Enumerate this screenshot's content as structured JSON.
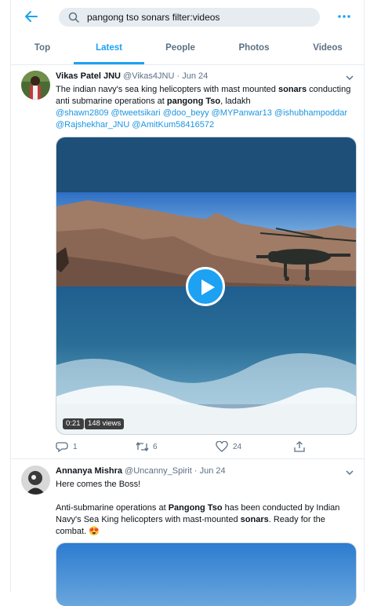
{
  "search": {
    "query": "pangong tso sonars filter:videos"
  },
  "tabs": [
    "Top",
    "Latest",
    "People",
    "Photos",
    "Videos"
  ],
  "active_tab": "Latest",
  "tweets": [
    {
      "name": "Vikas Patel JNU",
      "handle": "@Vikas4JNU",
      "sep": "·",
      "date": "Jun 24",
      "text_a": "The indian navy's sea king helicopters with mast mounted ",
      "text_b": "sonars",
      "text_c": " conducting anti submarine operations at ",
      "text_d": "pangong Tso",
      "text_e": ", ladakh",
      "mentions": [
        "@shawn2809",
        "@tweetsikari",
        "@doo_beyy",
        "@MYPanwar13",
        "@ishubhampoddar",
        "@Rajshekhar_JNU",
        "@AmitKum58416572"
      ],
      "video_time": "0:21",
      "video_views": "148 views",
      "replies": "1",
      "retweets": "6",
      "likes": "24"
    },
    {
      "name": "Annanya Mishra",
      "handle": "@Uncanny_Spirit",
      "sep": "·",
      "date": "Jun 24",
      "line1": "Here comes the Boss!",
      "p_a": "Anti-submarine operations at ",
      "p_b": "Pangong Tso",
      "p_c": " has been conducted by Indian Navy's Sea King helicopters with mast-mounted ",
      "p_d": "sonars",
      "p_e": ". Ready for the combat. ",
      "emoji": "😍"
    }
  ],
  "colors": {
    "accent": "#1da1f2",
    "mention": "#1b95e0",
    "muted": "#5b7083"
  }
}
